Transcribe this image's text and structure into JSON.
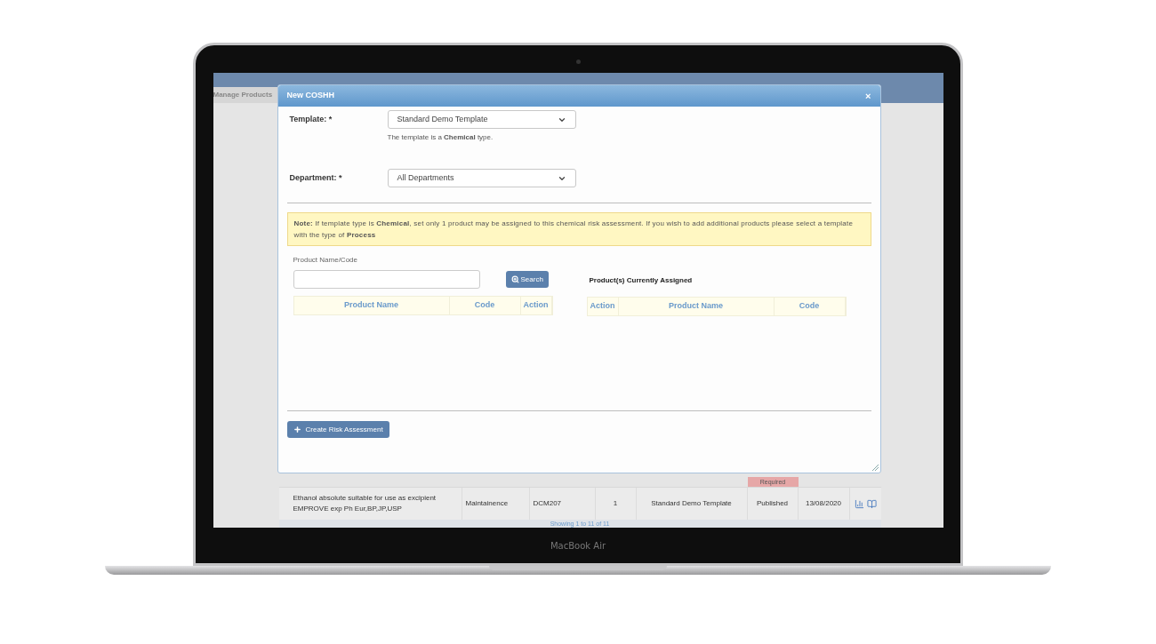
{
  "laptop": {
    "label": "MacBook Air"
  },
  "background": {
    "tab": "Manage Products",
    "status_badge": "Required",
    "row": [
      "Ethanol absolute suitable for use as excipient EMPROVE exp Ph Eur,BP,JP,USP",
      "Maintainence",
      "DCM207",
      "1",
      "Standard Demo Template",
      "Published",
      "13/08/2020"
    ],
    "footer": "Showing 1 to 11 of 11"
  },
  "modal": {
    "title": "New COSHH",
    "close": "×",
    "fields": [
      {
        "label": "Template: *",
        "value": "Standard Demo Template",
        "help": "The template is a **Chemical** type."
      },
      {
        "label": "Department: *",
        "value": "All Departments"
      }
    ],
    "note": "**Note:** If template type is **Chemical**, set only 1 product may be assigned to this chemical risk assessment. If you wish to add additional products please select a template with the type of **Process**",
    "search": {
      "label": "Product Name/Code",
      "button": "Search"
    },
    "search_columns": [
      "Product Name",
      "Code",
      "Action"
    ],
    "assigned_title": "Product(s) Currently Assigned",
    "assigned_columns": [
      "Action",
      "Product Name",
      "Code"
    ],
    "create_button": "Create Risk Assessment"
  }
}
